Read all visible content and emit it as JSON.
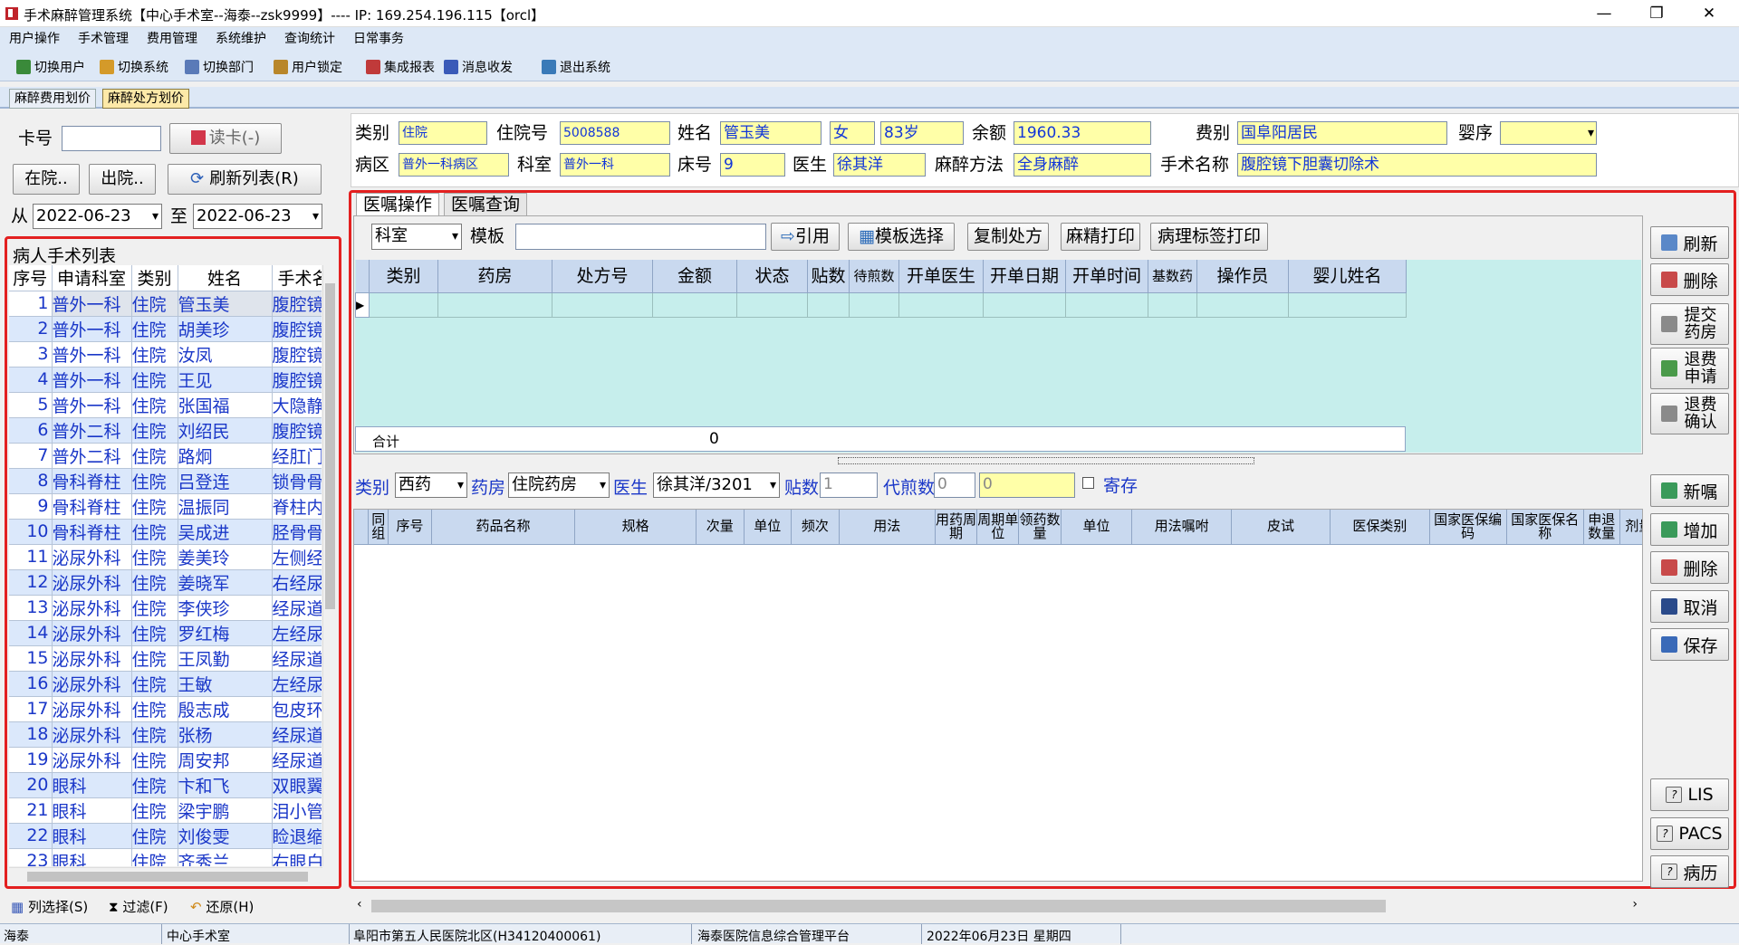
{
  "window": {
    "title": "手术麻醉管理系统【中心手术室--海泰--zsk9999】---- IP: 169.254.196.115【orcl】",
    "minimize": "—",
    "maximize": "❐",
    "close": "✕"
  },
  "menu": [
    "用户操作",
    "手术管理",
    "费用管理",
    "系统维护",
    "查询统计",
    "日常事务"
  ],
  "toolbar": [
    {
      "label": "切换用户",
      "icon": "users-icon",
      "color": "#3a8a3a"
    },
    {
      "label": "切换系统",
      "icon": "switch-icon",
      "color": "#d49a2a"
    },
    {
      "label": "切换部门",
      "icon": "department-icon",
      "color": "#5a7ab8"
    },
    {
      "label": "用户锁定",
      "icon": "lock-user-icon",
      "color": "#b8862a"
    },
    {
      "label": "集成报表",
      "icon": "report-icon",
      "color": "#c03a3a"
    },
    {
      "label": "消息收发",
      "icon": "info-icon",
      "color": "#3a5ab8"
    },
    {
      "label": "退出系统",
      "icon": "exit-icon",
      "color": "#3a7ab8"
    }
  ],
  "tabs": [
    {
      "label": "麻醉费用划价"
    },
    {
      "label": "麻醉处方划价"
    }
  ],
  "left": {
    "card_label": "卡号",
    "card_value": "",
    "read_card": "读卡(-)",
    "btn_inhospital": "在院..",
    "btn_discharged": "出院..",
    "btn_refresh": "刷新列表(R)",
    "from_label": "从",
    "to_label": "至",
    "date_from": "2022-06-23",
    "date_to": "2022-06-23",
    "list_title": "病人手术列表",
    "columns": [
      "序号",
      "申请科室",
      "类别",
      "姓名",
      "手术名"
    ],
    "rows": [
      [
        "1",
        "普外一科",
        "住院",
        "管玉美",
        "腹腔镜"
      ],
      [
        "2",
        "普外一科",
        "住院",
        "胡美珍",
        "腹腔镜"
      ],
      [
        "3",
        "普外一科",
        "住院",
        "汝凤",
        "腹腔镜"
      ],
      [
        "4",
        "普外一科",
        "住院",
        "王见",
        "腹腔镜"
      ],
      [
        "5",
        "普外一科",
        "住院",
        "张国福",
        "大隐静"
      ],
      [
        "6",
        "普外二科",
        "住院",
        "刘绍民",
        "腹腔镜"
      ],
      [
        "7",
        "普外二科",
        "住院",
        "路炯",
        "经肛门"
      ],
      [
        "8",
        "骨科脊柱",
        "住院",
        "吕登连",
        "锁骨骨"
      ],
      [
        "9",
        "骨科脊柱",
        "住院",
        "温振同",
        "脊柱内"
      ],
      [
        "10",
        "骨科脊柱",
        "住院",
        "吴成进",
        "胫骨骨"
      ],
      [
        "11",
        "泌尿外科",
        "住院",
        "姜美玲",
        "左侧经"
      ],
      [
        "12",
        "泌尿外科",
        "住院",
        "姜晓军",
        "右经尿"
      ],
      [
        "13",
        "泌尿外科",
        "住院",
        "李侠珍",
        "经尿道"
      ],
      [
        "14",
        "泌尿外科",
        "住院",
        "罗红梅",
        "左经尿"
      ],
      [
        "15",
        "泌尿外科",
        "住院",
        "王凤勤",
        "经尿道"
      ],
      [
        "16",
        "泌尿外科",
        "住院",
        "王敏",
        "左经尿"
      ],
      [
        "17",
        "泌尿外科",
        "住院",
        "殷志成",
        "包皮环"
      ],
      [
        "18",
        "泌尿外科",
        "住院",
        "张杨",
        "经尿道"
      ],
      [
        "19",
        "泌尿外科",
        "住院",
        "周安邦",
        "经尿道"
      ],
      [
        "20",
        "眼科",
        "住院",
        "卞和飞",
        "双眼翼"
      ],
      [
        "21",
        "眼科",
        "住院",
        "梁宇鹏",
        "泪小管"
      ],
      [
        "22",
        "眼科",
        "住院",
        "刘俊雯",
        "睑退缩"
      ],
      [
        "23",
        "眼科",
        "住院",
        "齐秀兰",
        "右眼白"
      ]
    ],
    "bottom": {
      "col_select": "列选择(S)",
      "filter": "过滤(F)",
      "restore": "还原(H)"
    }
  },
  "patient": {
    "type_label": "类别",
    "type": "住院",
    "inpatient_no_label": "住院号",
    "inpatient_no": "5008588",
    "name_label": "姓名",
    "name": "管玉美",
    "sex": "女",
    "age": "83岁",
    "balance_label": "余额",
    "balance": "1960.33",
    "fee_type_label": "费别",
    "fee_type": "国阜阳居民",
    "baby_label": "婴序",
    "baby": "",
    "ward_label": "病区",
    "ward": "普外一科病区",
    "dept_label": "科室",
    "dept": "普外一科",
    "bed_label": "床号",
    "bed": "9",
    "doctor_label": "医生",
    "doctor": "徐其洋",
    "anes_label": "麻醉方法",
    "anes": "全身麻醉",
    "surgery_label": "手术名称",
    "surgery": "腹腔镜下胆囊切除术"
  },
  "order": {
    "tabs": [
      "医嘱操作",
      "医嘱查询"
    ],
    "dept_combo": "科室",
    "template_label": "模板",
    "template_value": "",
    "btn_quote": "引用",
    "btn_template": "模板选择",
    "btn_copy": "复制处方",
    "btn_print_anes": "麻精打印",
    "btn_print_label": "病理标签打印",
    "columns": [
      "类别",
      "药房",
      "处方号",
      "金额",
      "状态",
      "贴数",
      "待煎数",
      "开单医生",
      "开单日期",
      "开单时间",
      "基数药",
      "操作员",
      "婴儿姓名"
    ],
    "total_label": "合计",
    "total_value": "0",
    "side_buttons": [
      "刷新",
      "删除",
      "提交药房",
      "退费申请",
      "退费确认"
    ],
    "filter": {
      "type_label": "类别",
      "type": "西药",
      "pharmacy_label": "药房",
      "pharmacy": "住院药房",
      "doctor_label": "医生",
      "doctor": "徐其洋/3201",
      "tie_label": "贴数",
      "tie": "1",
      "daijian_label": "代煎数",
      "daijian": "0",
      "extra": "0",
      "save_label": "寄存"
    },
    "detail_columns": [
      "同组",
      "序号",
      "药品名称",
      "规格",
      "次量",
      "单位",
      "频次",
      "用法",
      "用药周期",
      "周期单位",
      "领药数量",
      "单位",
      "用法嘱咐",
      "皮试",
      "医保类别",
      "国家医保编码",
      "国家医保名称",
      "申退数量",
      "剂量"
    ],
    "detail_buttons": [
      "新嘱",
      "增加",
      "删除",
      "取消",
      "保存"
    ],
    "extra_buttons": [
      "LIS",
      "PACS",
      "病历"
    ]
  },
  "status": [
    "海泰",
    "中心手术室",
    "阜阳市第五人民医院北区(H34120400061)",
    "海泰医院信息综合管理平台",
    "2022年06月23日 星期四"
  ]
}
